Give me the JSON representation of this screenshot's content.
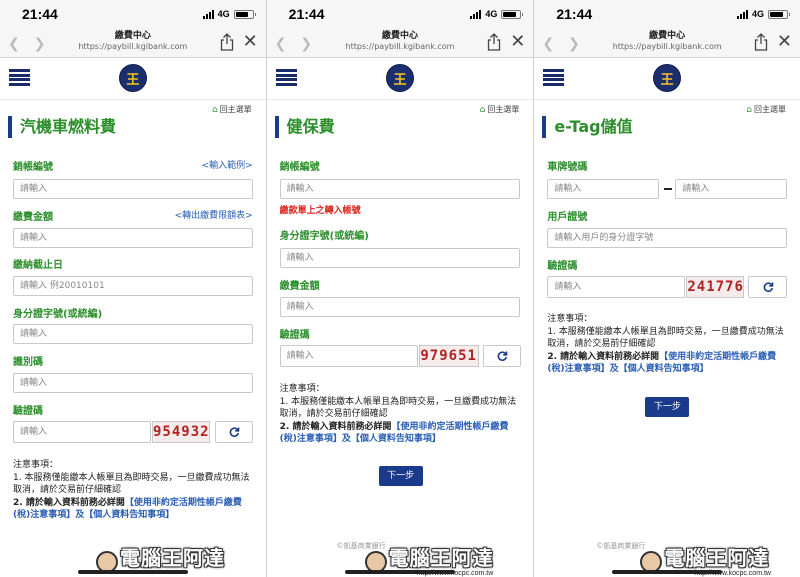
{
  "status": {
    "time": "21:44",
    "network": "4G"
  },
  "browser": {
    "title": "繳費中心",
    "url": "https://paybill.kgibank.com"
  },
  "logo_text": "王",
  "home_link": "回主選單",
  "placeholder": "請輸入",
  "next_label": "下一步",
  "colors": {
    "accent_green": "#2c8f2c",
    "brand_navy": "#1a3b8c",
    "link_blue": "#2a5fb5",
    "warn_red": "#d9231c",
    "captcha_red": "#b22222"
  },
  "watermark": {
    "text": "電腦王阿達",
    "url": "http://www.kocpc.com.tw",
    "copyright": "©凱基商業銀行"
  },
  "panels": [
    {
      "title": "汽機車燃料費",
      "fields": {
        "account_label": "銷帳編號",
        "account_link": "<輸入範例>",
        "account_placeholder": "請輸入",
        "amount_label": "繳費金額",
        "amount_link": "<轉出繳費限額表>",
        "amount_placeholder": "請輸入",
        "deadline_label": "繳納截止日",
        "deadline_placeholder": "請輸入 例20010101",
        "id_label": "身分證字號(或統編)",
        "id_placeholder": "請輸入",
        "ident_label": "識別碼",
        "ident_placeholder": "請輸入",
        "captcha_label": "驗證碼",
        "captcha_placeholder": "請輸入",
        "captcha_code": "954932"
      },
      "notes": {
        "heading": "注意事項：",
        "line1": "1. 本服務僅能繳本人帳單且為即時交易，一旦繳費成功無法取消，請於交易前仔細確認",
        "line2_prefix": "2. 請於輸入資料前務必詳閱",
        "line2_link": "【使用非約定活期性帳戶繳費(稅)注意事項】及【個人資料告知事項】"
      }
    },
    {
      "title": "健保費",
      "fields": {
        "account_label": "銷帳編號",
        "account_placeholder": "請輸入",
        "account_note": "繳款單上之轉入帳號",
        "id_label": "身分證字號(或統編)",
        "id_placeholder": "請輸入",
        "amount_label": "繳費金額",
        "amount_placeholder": "請輸入",
        "captcha_label": "驗證碼",
        "captcha_placeholder": "請輸入",
        "captcha_code": "979651"
      },
      "notes": {
        "heading": "注意事項：",
        "line1": "1. 本服務僅能繳本人帳單且為即時交易，一旦繳費成功無法取消，請於交易前仔細確認",
        "line2_prefix": "2. 請於輸入資料前務必詳閱",
        "line2_link": "【使用非約定活期性帳戶繳費(稅)注意事項】及【個人資料告知事項】"
      }
    },
    {
      "title": "e-Tag儲值",
      "fields": {
        "plate_label": "車牌號碼",
        "plate_placeholder_1": "請輸入",
        "plate_placeholder_2": "請輸入",
        "user_id_label": "用戶證號",
        "user_id_placeholder": "請輸入用戶的身分證字號",
        "captcha_label": "驗證碼",
        "captcha_placeholder": "請輸入",
        "captcha_code": "241776"
      },
      "notes": {
        "heading": "注意事項：",
        "line1": "1. 本服務僅能繳本人帳單且為即時交易，一旦繳費成功無法取消，請於交易前仔細確認",
        "line2_prefix": "2. 請於輸入資料前務必詳閱",
        "line2_link": "【使用非約定活期性帳戶繳費(稅)注意事項】及【個人資料告知事項】"
      }
    }
  ]
}
